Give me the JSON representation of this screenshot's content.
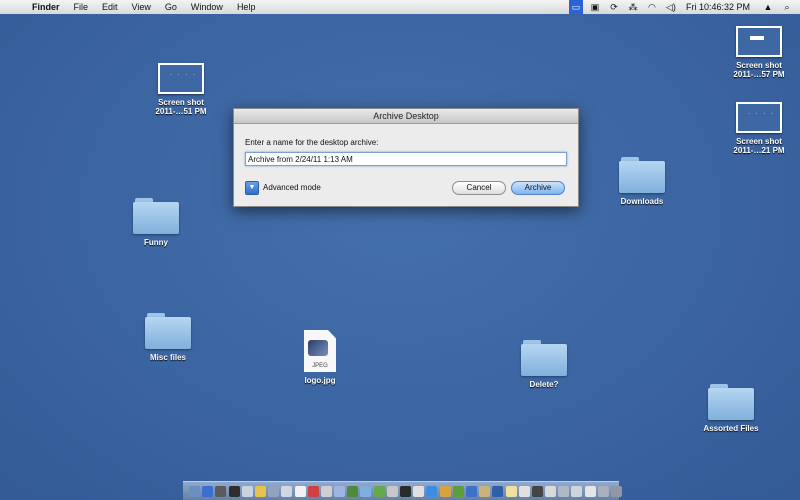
{
  "menubar": {
    "apple_glyph": "",
    "app_name": "Finder",
    "menus": [
      "File",
      "Edit",
      "View",
      "Go",
      "Window",
      "Help"
    ],
    "clock": "Fri 10:46:32 PM",
    "status_icons": [
      "screen-sharing-icon",
      "display-icon",
      "sync-icon",
      "bluetooth-icon",
      "wifi-icon",
      "volume-icon",
      "user-icon",
      "spotlight-icon"
    ]
  },
  "desktop_icons": {
    "screenshot_left": {
      "line1": "Screen shot",
      "line2": "2011-…51 PM"
    },
    "screenshot_top_right": {
      "line1": "Screen shot",
      "line2": "2011-…57 PM"
    },
    "screenshot_right": {
      "line1": "Screen shot",
      "line2": "2011-…21 PM"
    },
    "funny": "Funny",
    "downloads": "Downloads",
    "misc_files": "Misc files",
    "logo": "logo.jpg",
    "logo_badge": "JPEG",
    "delete": "Delete?",
    "assorted_files": "Assorted Files"
  },
  "dialog": {
    "title": "Archive Desktop",
    "prompt": "Enter a name for the desktop archive:",
    "name_value": "Archive from 2/24/11 1:13 AM",
    "advanced_label": "Advanced mode",
    "cancel_label": "Cancel",
    "archive_label": "Archive"
  },
  "dock": {
    "item_colors": [
      "#6c8fc2",
      "#3a6fd0",
      "#5a5a5a",
      "#2d2d2d",
      "#c9d3e0",
      "#e8c34a",
      "#8fa3c0",
      "#d0d7e3",
      "#f1f1f1",
      "#d04040",
      "#cfcfcf",
      "#9cb6e0",
      "#4f8a3a",
      "#7db0e0",
      "#68a84c",
      "#c7c7c7",
      "#2a2a2a",
      "#e0e0e0",
      "#3a8fe0",
      "#d7a43c",
      "#5c9e3c",
      "#3a72c8",
      "#c8b47a",
      "#2f5fa8",
      "#f0e0a0",
      "#e0e0e0",
      "#444444",
      "#d9d9d9",
      "#b0b8c8",
      "#cfd5df",
      "#e5e5e5",
      "#a8b0bd",
      "#9098a6"
    ]
  }
}
